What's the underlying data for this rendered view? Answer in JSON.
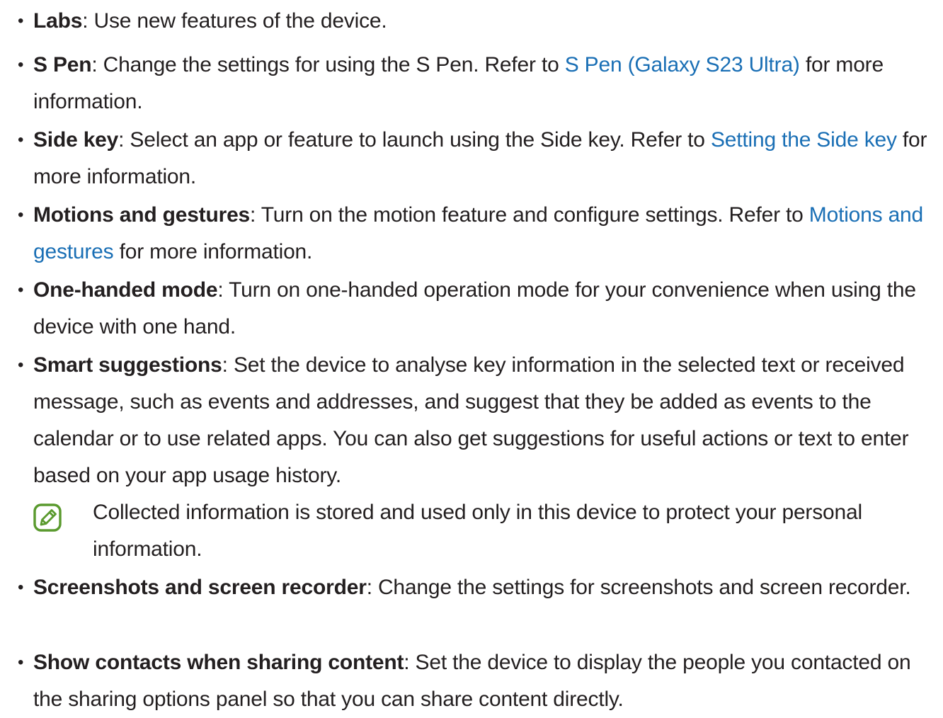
{
  "bullet": "•",
  "items": [
    {
      "term": "Labs",
      "sep": ":",
      "before": " Use new features of the device.",
      "link": "",
      "after": ""
    },
    {
      "term": "S Pen",
      "sep": ":",
      "before": " Change the settings for using the S Pen. Refer to ",
      "link": "S Pen (Galaxy S23 Ultra)",
      "after": " for more information."
    },
    {
      "term": "Side key",
      "sep": ":",
      "before": " Select an app or feature to launch using the Side key. Refer to ",
      "link": "Setting the Side key",
      "after": " for more information."
    },
    {
      "term": "Motions and gestures",
      "sep": ":",
      "before": " Turn on the motion feature and configure settings. Refer to ",
      "link": "Motions and gestures",
      "after": " for more information."
    },
    {
      "term": "One-handed mode",
      "sep": ":",
      "before": " Turn on one-handed operation mode for your convenience when using the device with one hand.",
      "link": "",
      "after": ""
    },
    {
      "term": "Smart suggestions",
      "sep": ":",
      "before": " Set the device to analyse key information in the selected text or received message, such as events and addresses, and suggest that they be added as events to the calendar or to use related apps. You can also get suggestions for useful actions or text to enter based on your app usage history.",
      "link": "",
      "after": ""
    },
    {
      "term": "Screenshots and screen recorder",
      "sep": ":",
      "before": " Change the settings for screenshots and screen recorder.",
      "link": "",
      "after": ""
    },
    {
      "term": "Show contacts when sharing content",
      "sep": ":",
      "before": " Set the device to display the people you contacted on the sharing options panel so that you can share content directly.",
      "link": "",
      "after": ""
    }
  ],
  "note": {
    "icon": "note-pencil-icon",
    "icon_color": "#5a9a2e",
    "text": "Collected information is stored and used only in this device to protect your personal information."
  },
  "colors": {
    "text": "#231f20",
    "link": "#1a6fb5"
  }
}
